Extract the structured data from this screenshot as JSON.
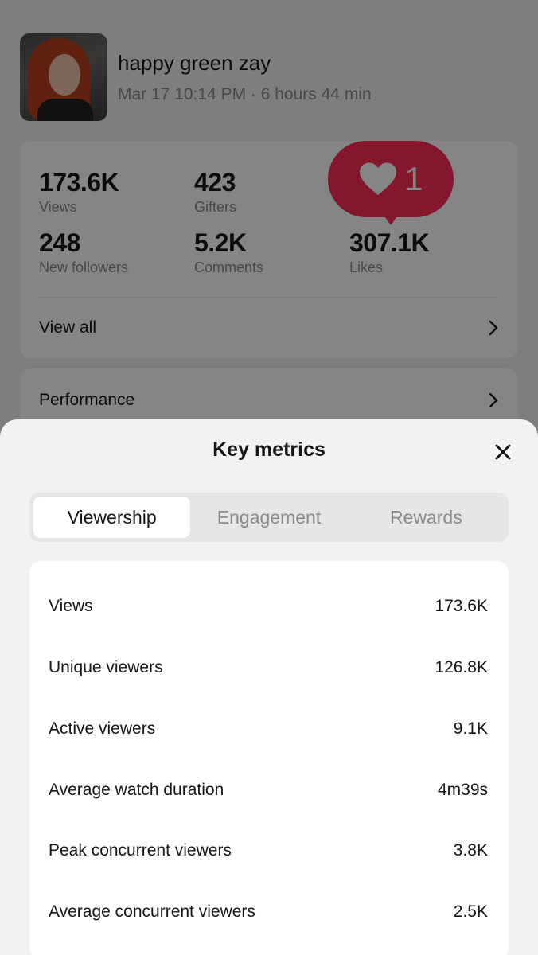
{
  "profile": {
    "name": "happy green zay",
    "subtitle": "Mar 17 10:14 PM · 6 hours 44 min"
  },
  "stats": {
    "views": {
      "value": "173.6K",
      "label": "Views"
    },
    "gifters": {
      "value": "423",
      "label": "Gifters"
    },
    "new_followers": {
      "value": "248",
      "label": "New followers"
    },
    "comments": {
      "value": "5.2K",
      "label": "Comments"
    },
    "likes": {
      "value": "307.1K",
      "label": "Likes"
    },
    "view_all_label": "View all"
  },
  "performance_label": "Performance",
  "like_popup": {
    "count": "1",
    "color": "#fe2c55"
  },
  "sheet": {
    "title": "Key metrics",
    "tabs": [
      {
        "label": "Viewership",
        "active": true
      },
      {
        "label": "Engagement",
        "active": false
      },
      {
        "label": "Rewards",
        "active": false
      }
    ],
    "metrics": [
      {
        "label": "Views",
        "value": "173.6K"
      },
      {
        "label": "Unique viewers",
        "value": "126.8K"
      },
      {
        "label": "Active viewers",
        "value": "9.1K"
      },
      {
        "label": "Average watch duration",
        "value": "4m39s"
      },
      {
        "label": "Peak concurrent viewers",
        "value": "3.8K"
      },
      {
        "label": "Average concurrent viewers",
        "value": "2.5K"
      }
    ]
  },
  "icons": {
    "close": "close-icon",
    "chevron": "chevron-right-icon",
    "heart": "heart-icon"
  }
}
